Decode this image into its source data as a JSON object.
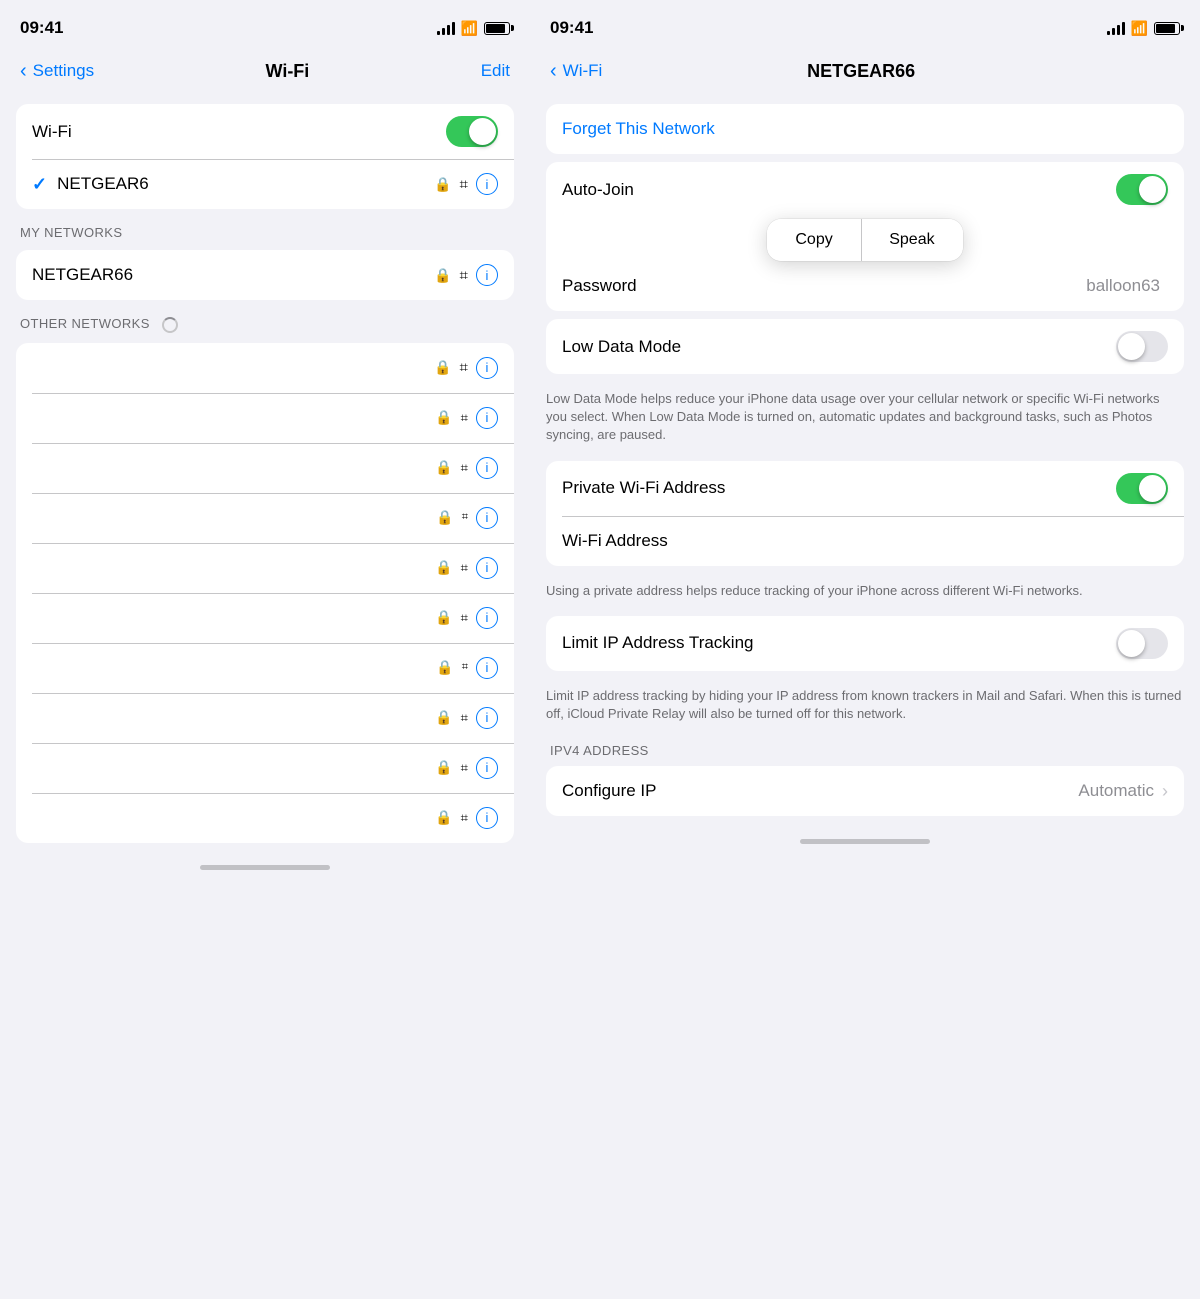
{
  "left": {
    "status": {
      "time": "09:41"
    },
    "nav": {
      "back_label": "Settings",
      "title": "Wi-Fi",
      "action": "Edit"
    },
    "wifi_row": {
      "label": "Wi-Fi",
      "toggle": "on"
    },
    "connected_network": {
      "name": "NETGEAR6"
    },
    "my_networks_header": "MY NETWORKS",
    "my_networks": [
      {
        "name": "NETGEAR66"
      }
    ],
    "other_networks_header": "OTHER NETWORKS",
    "other_networks": [
      {},
      {},
      {},
      {},
      {},
      {},
      {},
      {},
      {},
      {}
    ],
    "home_bar": true
  },
  "right": {
    "status": {
      "time": "09:41"
    },
    "nav": {
      "back_label": "Wi-Fi",
      "title": "NETGEAR66"
    },
    "forget_network": "Forget This Network",
    "auto_join": {
      "label": "Auto-Join",
      "toggle": "on"
    },
    "context_menu": {
      "copy": "Copy",
      "speak": "Speak"
    },
    "password": {
      "label": "Password",
      "value": "balloon63"
    },
    "low_data_mode": {
      "label": "Low Data Mode",
      "toggle": "off",
      "description": "Low Data Mode helps reduce your iPhone data usage over your cellular network or specific Wi-Fi networks you select. When Low Data Mode is turned on, automatic updates and background tasks, such as Photos syncing, are paused."
    },
    "private_wifi": {
      "label": "Private Wi-Fi Address",
      "toggle": "on"
    },
    "wifi_address": {
      "label": "Wi-Fi Address",
      "description": "Using a private address helps reduce tracking of your iPhone across different Wi-Fi networks."
    },
    "limit_ip": {
      "label": "Limit IP Address Tracking",
      "toggle": "off",
      "description": "Limit IP address tracking by hiding your IP address from known trackers in Mail and Safari. When this is turned off, iCloud Private Relay will also be turned off for this network."
    },
    "ipv4_header": "IPV4 ADDRESS",
    "configure_ip": {
      "label": "Configure IP",
      "value": "Automatic"
    },
    "home_bar": true
  }
}
